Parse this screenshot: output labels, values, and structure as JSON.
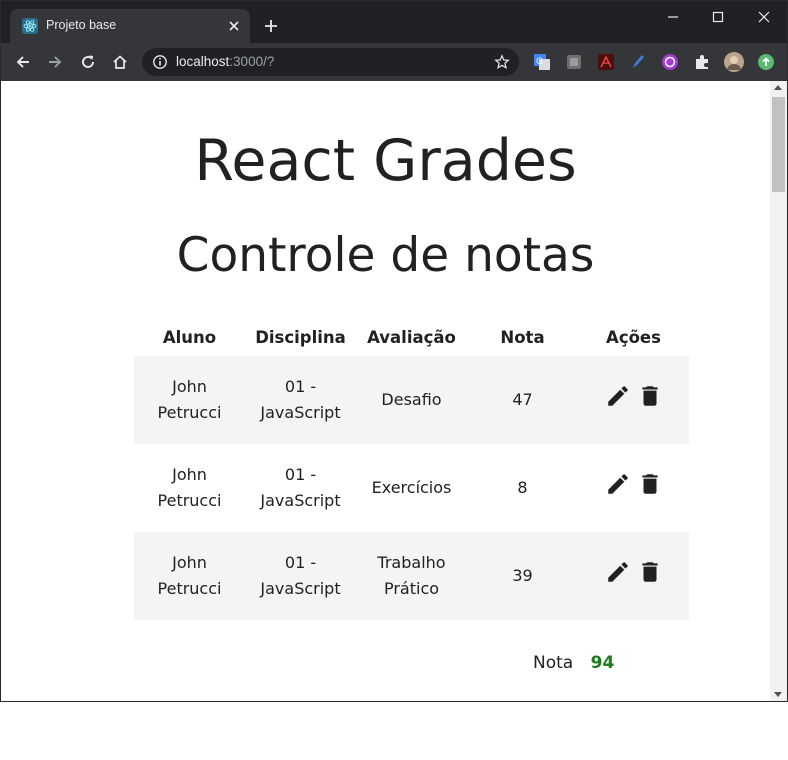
{
  "browser": {
    "tab_title": "Projeto base",
    "url_host": "localhost",
    "url_path": ":3000/?"
  },
  "page": {
    "title": "React Grades",
    "subtitle": "Controle de notas"
  },
  "table": {
    "headers": [
      "Aluno",
      "Disciplina",
      "Avaliação",
      "Nota",
      "Ações"
    ],
    "rows": [
      {
        "aluno_first": "John",
        "aluno_last": "Petrucci",
        "disc_code": "01 -",
        "disc_name": "JavaScript",
        "aval_1": "Desafio",
        "aval_2": "",
        "nota": "47"
      },
      {
        "aluno_first": "John",
        "aluno_last": "Petrucci",
        "disc_code": "01 -",
        "disc_name": "JavaScript",
        "aval_1": "Exercícios",
        "aval_2": "",
        "nota": "8"
      },
      {
        "aluno_first": "John",
        "aluno_last": "Petrucci",
        "disc_code": "01 -",
        "disc_name": "JavaScript",
        "aval_1": "Trabalho",
        "aval_2": "Prático",
        "nota": "39"
      }
    ],
    "row_actions": [
      "edit-icon",
      "delete-icon"
    ]
  },
  "total": {
    "label": "Nota",
    "value": "94",
    "value_color": "#1b7a1b"
  },
  "icons": {
    "favicon": "react-icon",
    "extensions": [
      "google-translate-icon",
      "extension-icon",
      "pdf-icon",
      "pen-icon",
      "vpn-icon",
      "puzzle-icon",
      "profile-avatar",
      "update-icon"
    ]
  }
}
